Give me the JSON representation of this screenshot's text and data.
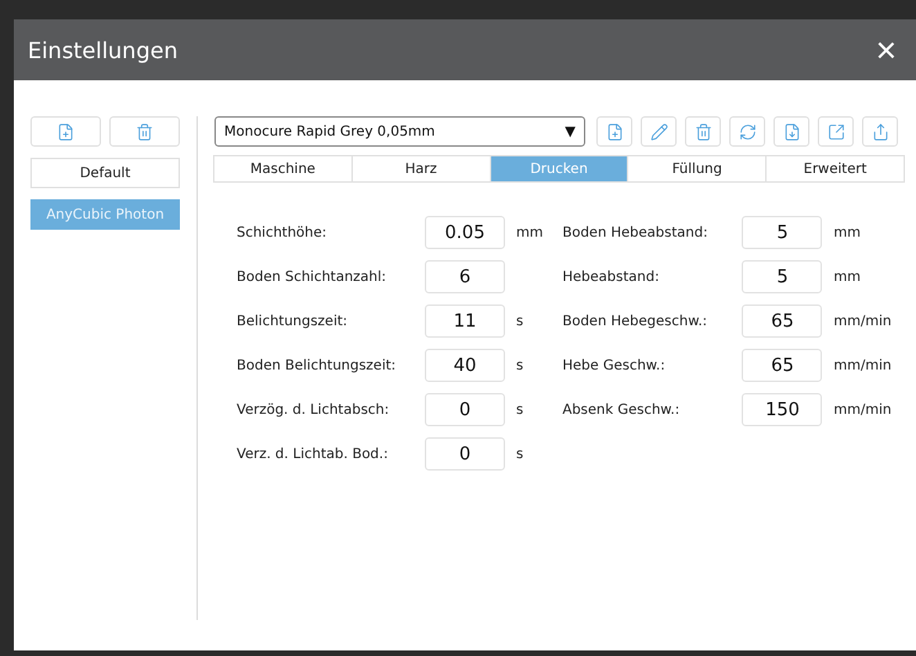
{
  "window": {
    "title": "Einstellungen",
    "close": "×"
  },
  "profile_actions": [
    {
      "kind": "add"
    },
    {
      "kind": "delete"
    }
  ],
  "profiles": [
    {
      "label": "Default",
      "selected": false
    },
    {
      "label": "AnyCubic Photon",
      "selected": true
    }
  ],
  "resin": {
    "value": "Monocure Rapid Grey 0,05mm",
    "caret": "▼"
  },
  "resin_actions": [
    {
      "kind": "add"
    },
    {
      "kind": "edit"
    },
    {
      "kind": "delete"
    },
    {
      "kind": "refresh"
    },
    {
      "kind": "import"
    },
    {
      "kind": "export"
    },
    {
      "kind": "share"
    }
  ],
  "tabs": [
    {
      "label": "Maschine",
      "selected": false
    },
    {
      "label": "Harz",
      "selected": false
    },
    {
      "label": "Drucken",
      "selected": true
    },
    {
      "label": "Füllung",
      "selected": false
    },
    {
      "label": "Erweitert",
      "selected": false
    }
  ],
  "left_fields": [
    {
      "label": "Schichthöhe:",
      "value": "0.05",
      "unit": "mm"
    },
    {
      "label": "Boden Schichtanzahl:",
      "value": "6"
    },
    {
      "label": "Belichtungszeit:",
      "value": "11",
      "unit": "s"
    },
    {
      "label": "Boden Belichtungszeit:",
      "value": "40",
      "unit": "s"
    },
    {
      "label": "Verzög. d. Lichtabsch:",
      "value": "0",
      "unit": "s"
    },
    {
      "label": "Verz. d. Lichtab. Bod.:",
      "value": "0",
      "unit": "s"
    }
  ],
  "right_fields": [
    {
      "label": "Boden Hebeabstand:",
      "value": "5",
      "unit": "mm"
    },
    {
      "label": "Hebeabstand:",
      "value": "5",
      "unit": "mm"
    },
    {
      "label": "Boden Hebegeschw.:",
      "value": "65",
      "unit": "mm/min"
    },
    {
      "label": "Hebe Geschw.:",
      "value": "65",
      "unit": "mm/min"
    },
    {
      "label": "Absenk Geschw.:",
      "value": "150",
      "unit": "mm/min"
    }
  ]
}
